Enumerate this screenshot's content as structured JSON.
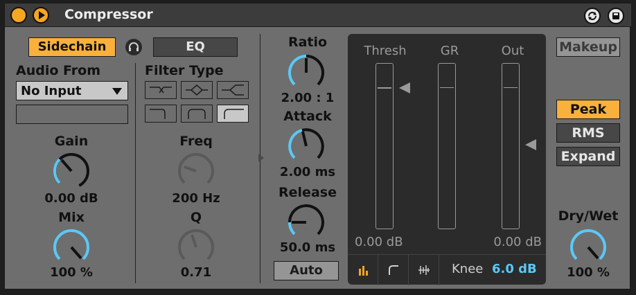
{
  "header": {
    "title": "Compressor"
  },
  "sidechain": {
    "label": "Sidechain",
    "eq_label": "EQ",
    "audio_from_label": "Audio From",
    "input_value": "No Input",
    "gain_label": "Gain",
    "gain_value": "0.00 dB",
    "gain_knob_level": 0.5,
    "mix_label": "Mix",
    "mix_value": "100 %",
    "mix_knob_level": 1.0
  },
  "filter": {
    "type_label": "Filter Type",
    "freq_label": "Freq",
    "freq_value": "200 Hz",
    "q_label": "Q",
    "q_value": "0.71"
  },
  "dynamics": {
    "ratio_label": "Ratio",
    "ratio_value": "2.00 : 1",
    "attack_label": "Attack",
    "attack_value": "2.00 ms",
    "release_label": "Release",
    "release_value": "50.0 ms",
    "auto_label": "Auto"
  },
  "meters": {
    "thresh_label": "Thresh",
    "gr_label": "GR",
    "out_label": "Out",
    "thresh_value": "0.00 dB",
    "out_value": "0.00 dB",
    "knee_label": "Knee",
    "knee_value": "6.0 dB"
  },
  "right": {
    "makeup_label": "Makeup",
    "peak_label": "Peak",
    "rms_label": "RMS",
    "expand_label": "Expand",
    "drywet_label": "Dry/Wet",
    "drywet_value": "100 %"
  },
  "colors": {
    "accent_orange": "#f9b03c",
    "knob_blue": "#5bc8f5",
    "panel": "#6e6e6e"
  }
}
